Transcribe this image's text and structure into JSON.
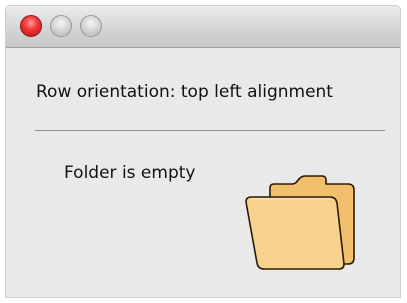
{
  "window": {
    "controls": {
      "close": "close-button",
      "minimize": "minimize-button",
      "zoom": "zoom-button"
    }
  },
  "content": {
    "heading": "Row orientation: top left alignment",
    "empty_message": "Folder is empty",
    "folder_icon": "folder-icon"
  },
  "colors": {
    "window_bg": "#e9e9e9",
    "folder_fill": "#f7cd82",
    "folder_stroke": "#2a1a07"
  }
}
